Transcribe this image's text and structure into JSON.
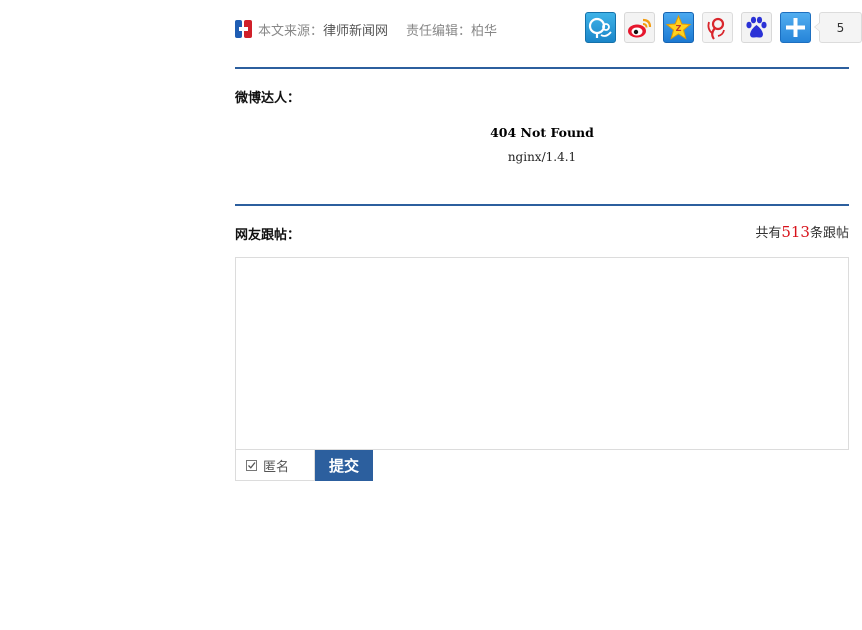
{
  "source": {
    "label": "本文来源：",
    "name": "律师新闻网",
    "editor_label": "责任编辑：",
    "editor_name": "柏华"
  },
  "share": {
    "count": "5",
    "icons": [
      "qzone-icon",
      "weibo-icon",
      "qq-star-icon",
      "tencent-weibo-icon",
      "baidu-icon",
      "more-plus-icon"
    ]
  },
  "weibo_section": {
    "title": "微博达人："
  },
  "embedded_error": {
    "title": "404 Not Found",
    "server": "nginx/1.4.1"
  },
  "comments": {
    "title": "网友跟帖：",
    "count_prefix": "共有",
    "count": "513",
    "count_suffix": "条跟帖",
    "textarea_value": "",
    "anonymous_label": "匿名",
    "anonymous_checked": true,
    "submit_label": "提交"
  },
  "colors": {
    "accent": "#2c5f9e",
    "count_red": "#d8111a"
  }
}
